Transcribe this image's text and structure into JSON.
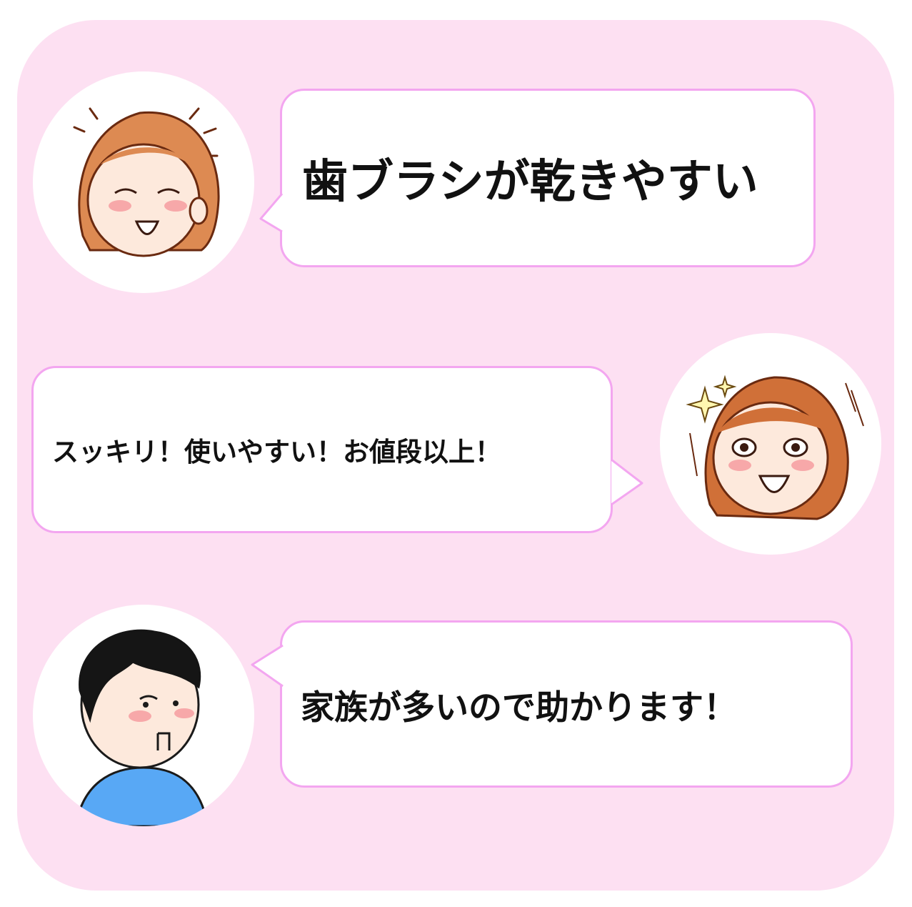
{
  "colors": {
    "panel_background": "#fde0f2",
    "bubble_border": "#f3a6f0",
    "text": "#111111",
    "hair_woman": "#dd8a52",
    "hair_man": "#151515",
    "shirt_man": "#58a8f5",
    "cheek_blush": "#f38b93"
  },
  "comments": [
    {
      "icon": "happy-woman-avatar-icon",
      "side": "left",
      "text": "歯ブラシが乾きやすい"
    },
    {
      "icon": "excited-woman-avatar-icon",
      "side": "right",
      "text": "スッキリ！使いやすい！お値段以上！"
    },
    {
      "icon": "man-avatar-icon",
      "side": "left",
      "text": "家族が多いので助かります！"
    }
  ]
}
